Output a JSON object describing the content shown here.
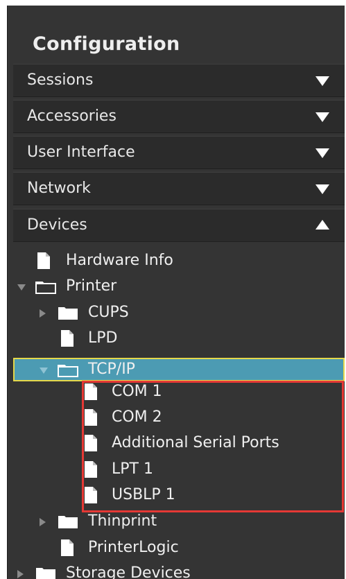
{
  "panel": {
    "title": "Configuration"
  },
  "sections": [
    {
      "label": "Sessions",
      "expanded": false
    },
    {
      "label": "Accessories",
      "expanded": false
    },
    {
      "label": "User Interface",
      "expanded": false
    },
    {
      "label": "Network",
      "expanded": false
    },
    {
      "label": "Devices",
      "expanded": true
    }
  ],
  "tree": {
    "hardware_info": "Hardware Info",
    "printer": "Printer",
    "cups": "CUPS",
    "lpd": "LPD",
    "tcpip": "TCP/IP",
    "com1": "COM 1",
    "com2": "COM 2",
    "additional_serial": "Additional Serial Ports",
    "lpt1": "LPT 1",
    "usblp1": "USBLP 1",
    "thinprint": "Thinprint",
    "printerlogic": "PrinterLogic",
    "storage_devices": "Storage Devices"
  },
  "colors": {
    "panel_bg": "#343434",
    "section_bg": "#2b2b2b",
    "selected_bg": "#4c9bb3",
    "selected_border": "#e5d84a",
    "annotation_red": "#e53935"
  },
  "icons": [
    "file-icon",
    "folder-icon",
    "expand-arrow-icon",
    "collapse-arrow-icon"
  ]
}
